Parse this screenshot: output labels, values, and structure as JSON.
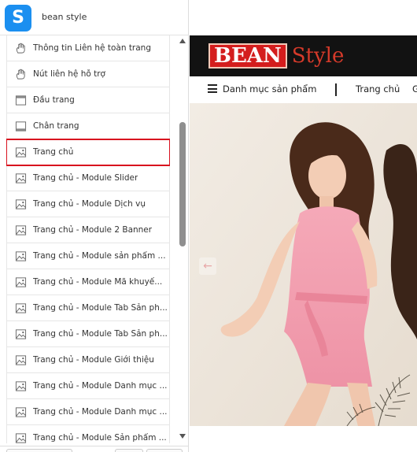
{
  "header": {
    "app_icon": "sapo-logo-icon",
    "app_letter": "S",
    "store_name": "bean style"
  },
  "sidebar": {
    "items": [
      {
        "label": "Thông tin Liên hệ toàn trang",
        "icon": "hand-icon"
      },
      {
        "label": "Nút liên hệ hỗ trợ",
        "icon": "hand-icon"
      },
      {
        "label": "Đầu trang",
        "icon": "header-layout-icon"
      },
      {
        "label": "Chân trang",
        "icon": "footer-layout-icon"
      },
      {
        "label": "Trang chủ",
        "icon": "image-icon",
        "selected": true
      },
      {
        "label": "Trang chủ - Module Slider",
        "icon": "image-icon"
      },
      {
        "label": "Trang chủ - Module Dịch vụ",
        "icon": "image-icon"
      },
      {
        "label": "Trang chủ - Module 2 Banner",
        "icon": "image-icon"
      },
      {
        "label": "Trang chủ - Module sản phẩm ...",
        "icon": "image-icon"
      },
      {
        "label": "Trang chủ - Module Mã khuyế...",
        "icon": "image-icon"
      },
      {
        "label": "Trang chủ - Module Tab Sản ph...",
        "icon": "image-icon"
      },
      {
        "label": "Trang chủ - Module Tab Sản ph...",
        "icon": "image-icon"
      },
      {
        "label": "Trang chủ - Module Giới thiệu",
        "icon": "image-icon"
      },
      {
        "label": "Trang chủ - Module Danh mục ...",
        "icon": "image-icon"
      },
      {
        "label": "Trang chủ - Module Danh mục ...",
        "icon": "image-icon"
      },
      {
        "label": "Trang chủ - Module Sản phẩm ...",
        "icon": "image-icon"
      }
    ],
    "selected_outline_color": "#d8121f"
  },
  "preview": {
    "logo_bean": "BEAN",
    "logo_style": "Style",
    "brand_red": "#d41d1d",
    "nav_category": "Danh mục sản phẩm",
    "nav_home": "Trang chủ",
    "nav_more": "G",
    "slider_prev_icon": "arrow-left-icon",
    "slider_prev_glyph": "←"
  }
}
